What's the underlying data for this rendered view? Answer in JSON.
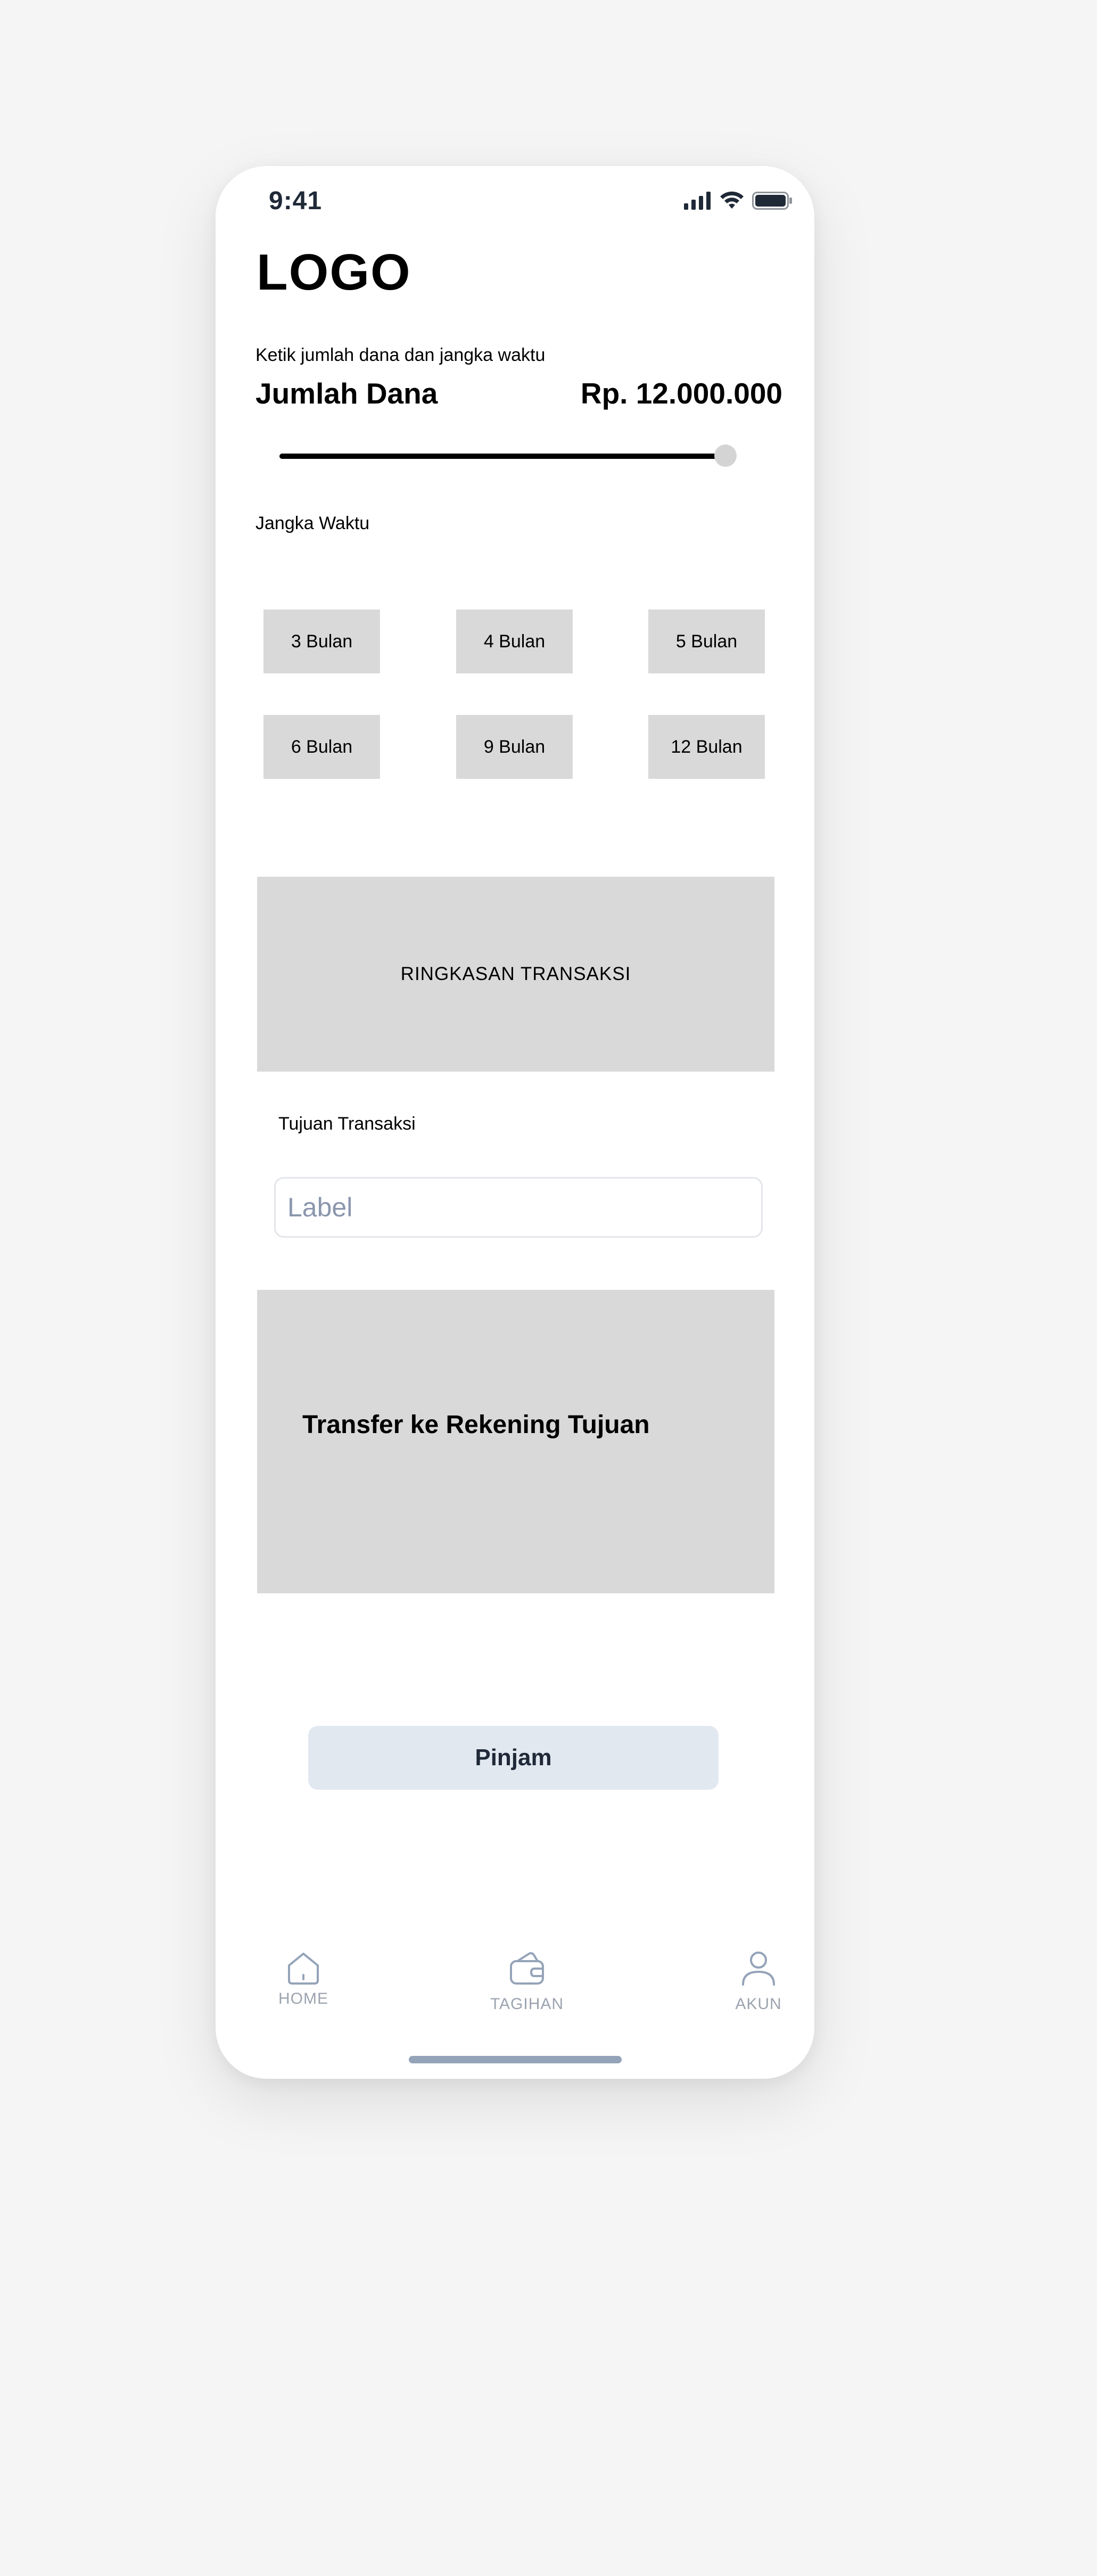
{
  "status_bar": {
    "time": "9:41",
    "icons": [
      "signal-icon",
      "wifi-icon",
      "battery-icon"
    ]
  },
  "logo": "LOGO",
  "amount": {
    "hint": "Ketik jumlah dana dan jangka waktu",
    "title": "Jumlah Dana",
    "value": "Rp. 12.000.000",
    "slider_fraction": 1.0
  },
  "duration": {
    "label": "Jangka Waktu",
    "options": [
      "3 Bulan",
      "4 Bulan",
      "5 Bulan",
      "6 Bulan",
      "9 Bulan",
      "12 Bulan"
    ]
  },
  "summary": {
    "label": "RINGKASAN TRANSAKSI"
  },
  "purpose": {
    "label": "Tujuan Transaksi",
    "placeholder": "Label",
    "value": ""
  },
  "transfer": {
    "label": "Transfer ke Rekening Tujuan"
  },
  "actions": {
    "submit_label": "Pinjam"
  },
  "bottom_nav": {
    "home": "HOME",
    "bills": "TAGIHAN",
    "account": "AKUN"
  },
  "colors": {
    "background": "#f5f5f5",
    "card": "#ffffff",
    "placeholder_block": "#d9d9d9",
    "button": "#e2e8f0",
    "nav_icon": "#94a3b8"
  }
}
